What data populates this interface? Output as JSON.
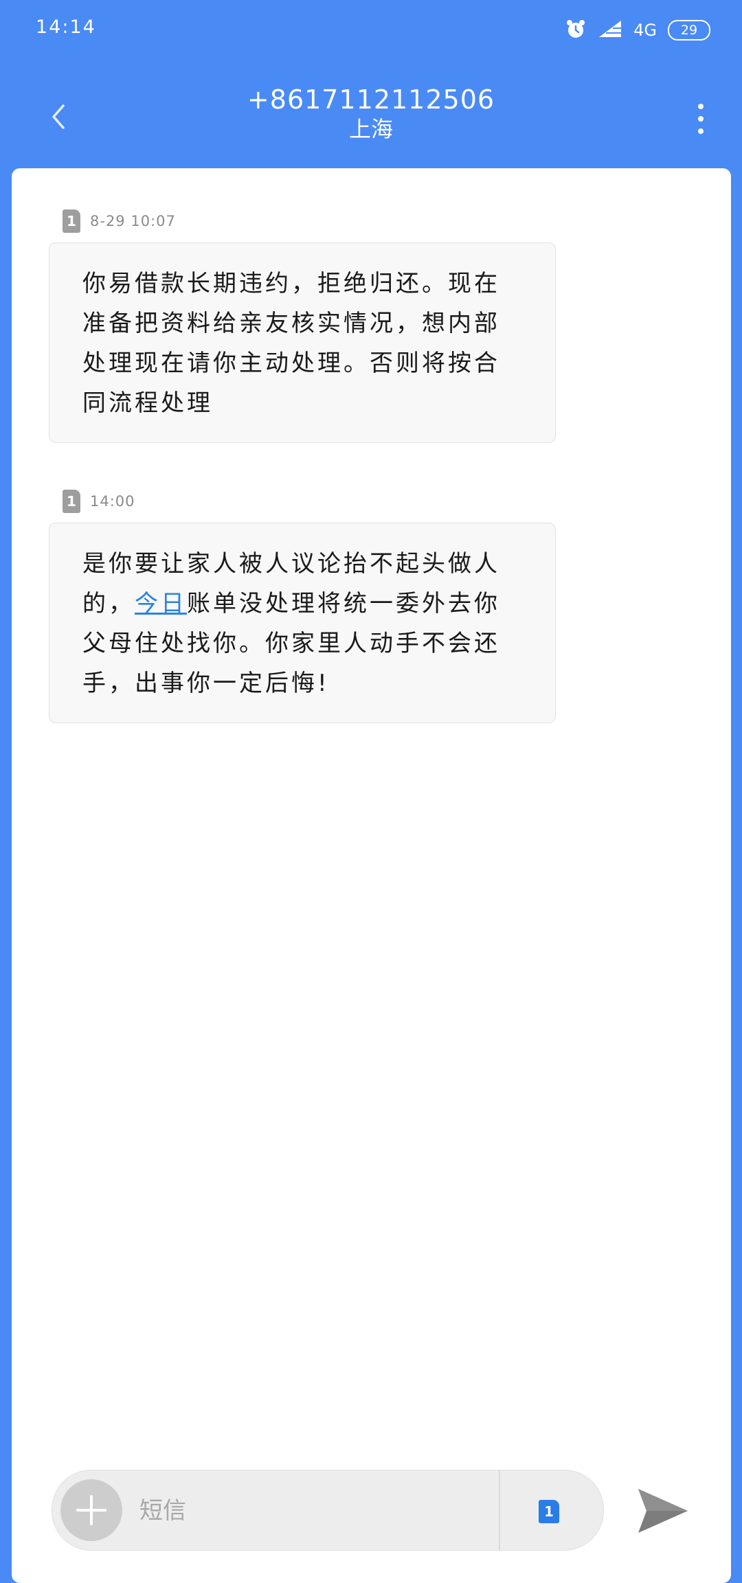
{
  "status_bar": {
    "time": "14:14",
    "network": "4G",
    "battery": "29",
    "icons": [
      "alarm-icon",
      "signal-icon",
      "battery-icon"
    ]
  },
  "header": {
    "number": "+8617112112506",
    "location": "上海"
  },
  "messages": [
    {
      "sim": "1",
      "time": "8-29 10:07",
      "text": "你易借款长期违约，拒绝归还。现在准备把资料给亲友核实情况，想内部处理现在请你主动处理。否则将按合同流程处理"
    },
    {
      "sim": "1",
      "time": "14:00",
      "text_before": "是你要让家人被人议论抬不起头做人的，",
      "link": "今日",
      "text_after": "账单没处理将统一委外去你父母住处找你。你家里人动手不会还手，出事你一定后悔!"
    }
  ],
  "composer": {
    "placeholder": "短信",
    "sim": "1"
  },
  "colors": {
    "header_bg": "#4a8af5",
    "link": "#2a82e4",
    "sim_active": "#2a7ce8"
  }
}
